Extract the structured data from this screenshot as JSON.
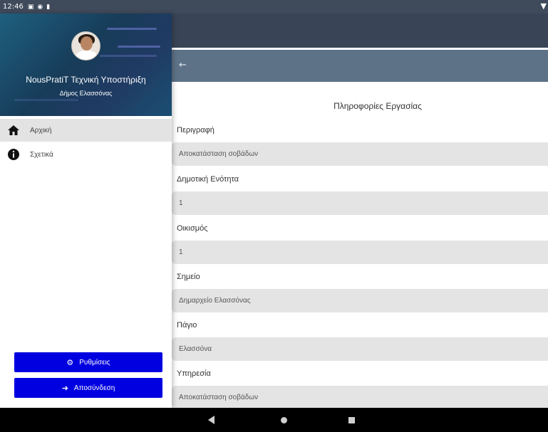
{
  "status_bar": {
    "time": "12:46",
    "icons": [
      "sim-icon",
      "app-icon",
      "notification-icon"
    ],
    "right_icons": [
      "wifi-icon",
      "battery-icon"
    ]
  },
  "drawer": {
    "title": "NousPratiT Τεχνική Υποστήριξη",
    "subtitle": "Δήμος Ελασσόνας",
    "items": [
      {
        "label": "Αρχική",
        "icon": "home-icon",
        "active": true
      },
      {
        "label": "Σχετικά",
        "icon": "info-icon",
        "active": false
      }
    ],
    "settings_label": "Ρυθμίσεις",
    "logout_label": "Αποσύνδεση"
  },
  "main": {
    "back_icon": "back-arrow-icon",
    "section_title": "Πληροφορίες Εργασίας",
    "fields": [
      {
        "label": "Περιγραφή",
        "value": "Αποκατάσταση σοβάδων"
      },
      {
        "label": "Δημοτική Ενότητα",
        "value": "1"
      },
      {
        "label": "Οικισμός",
        "value": "1"
      },
      {
        "label": "Σημείο",
        "value": "Δημαρχείο Ελασσόνας"
      },
      {
        "label": "Πάγιο",
        "value": "Ελασσόνα"
      },
      {
        "label": "Υπηρεσία",
        "value": "Αποκατάσταση σοβάδων"
      }
    ]
  },
  "colors": {
    "accent_button": "#0000e0",
    "toolbar": "#5e7287",
    "top_dark": "#394556",
    "field_bg": "#e4e4e4"
  }
}
